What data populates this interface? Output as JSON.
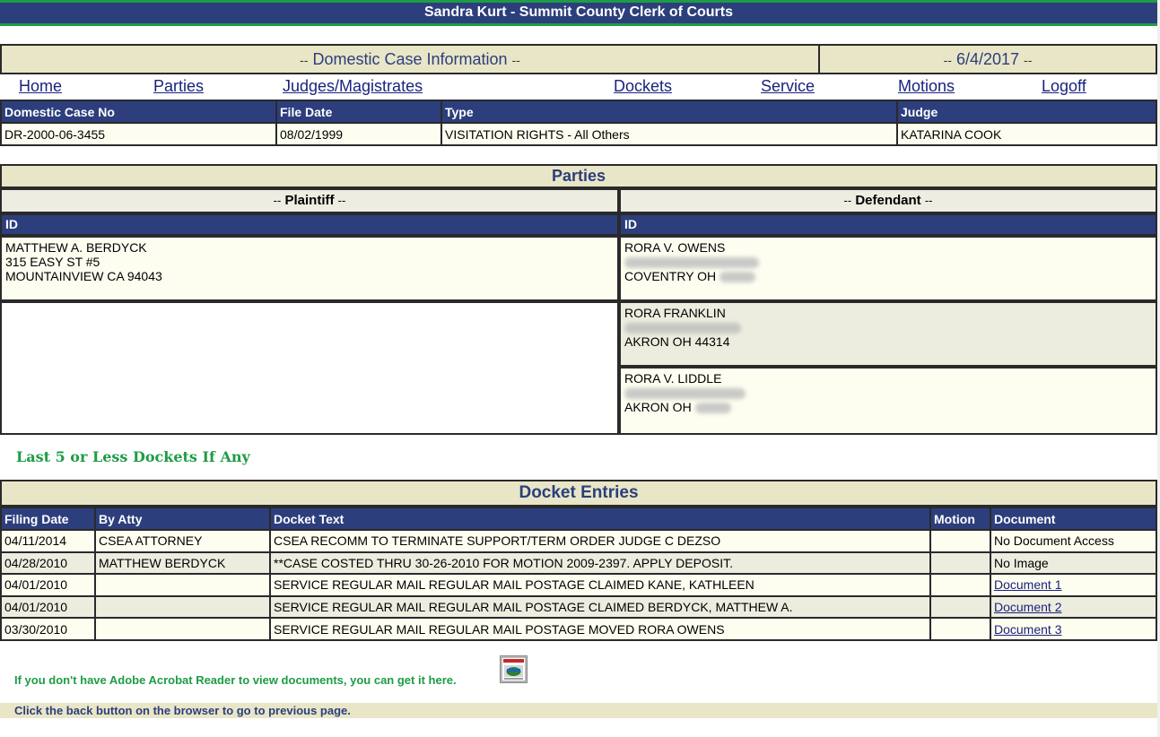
{
  "header": {
    "title": "Sandra Kurt - Summit County Clerk of Courts"
  },
  "info": {
    "title": "Domestic Case Information",
    "date": "6/4/2017",
    "dash": "--"
  },
  "nav": [
    {
      "label": "Home"
    },
    {
      "label": "Parties"
    },
    {
      "label": "Judges/Magistrates"
    },
    {
      "label": "Dockets"
    },
    {
      "label": "Service"
    },
    {
      "label": "Motions"
    },
    {
      "label": "Logoff"
    }
  ],
  "case": {
    "headers": [
      "Domestic Case No",
      "File Date",
      "Type",
      "Judge"
    ],
    "values": [
      "DR-2000-06-3455",
      "08/02/1999",
      "VISITATION RIGHTS - All Others",
      "KATARINA COOK"
    ]
  },
  "parties": {
    "title": "Parties",
    "plaintiff_label": "Plaintiff",
    "defendant_label": "Defendant",
    "id_label": "ID",
    "plaintiff": {
      "name": "MATTHEW A. BERDYCK",
      "street": "315 EASY ST #5",
      "city": "MOUNTAINVIEW CA 94043"
    },
    "defendants": [
      {
        "name": "RORA V. OWENS",
        "city": "COVENTRY OH"
      },
      {
        "name": "RORA FRANKLIN",
        "city": "AKRON OH 44314"
      },
      {
        "name": "RORA V. LIDDLE",
        "city": "AKRON OH"
      }
    ]
  },
  "dockets": {
    "label": "Last 5 or Less Dockets If Any",
    "title": "Docket Entries",
    "headers": [
      "Filing Date",
      "By Atty",
      "Docket Text",
      "Motion",
      "Document"
    ],
    "rows": [
      {
        "date": "04/11/2014",
        "atty": "CSEA ATTORNEY",
        "text": "CSEA RECOMM TO TERMINATE SUPPORT/TERM ORDER JUDGE C DEZSO",
        "motion": "",
        "document": "No Document Access"
      },
      {
        "date": "04/28/2010",
        "atty": "MATTHEW BERDYCK",
        "text": "**CASE COSTED THRU 30-26-2010 FOR MOTION 2009-2397. APPLY DEPOSIT.",
        "motion": "",
        "document": "No Image"
      },
      {
        "date": "04/01/2010",
        "atty": "",
        "text": "SERVICE REGULAR MAIL REGULAR MAIL POSTAGE CLAIMED KANE, KATHLEEN",
        "motion": "",
        "document": "Document 1"
      },
      {
        "date": "04/01/2010",
        "atty": "",
        "text": "SERVICE REGULAR MAIL REGULAR MAIL POSTAGE CLAIMED BERDYCK, MATTHEW A.",
        "motion": "",
        "document": "Document 2"
      },
      {
        "date": "03/30/2010",
        "atty": "",
        "text": "SERVICE REGULAR MAIL REGULAR MAIL POSTAGE MOVED RORA OWENS",
        "motion": "",
        "document": "Document 3"
      }
    ]
  },
  "footer": {
    "acrobat_text": "If you don't have Adobe Acrobat Reader to view documents, you can get it here.",
    "acrobat_icon": "acrobat-reader-icon",
    "back_text": "Click the back button on the browser to go to previous page."
  }
}
